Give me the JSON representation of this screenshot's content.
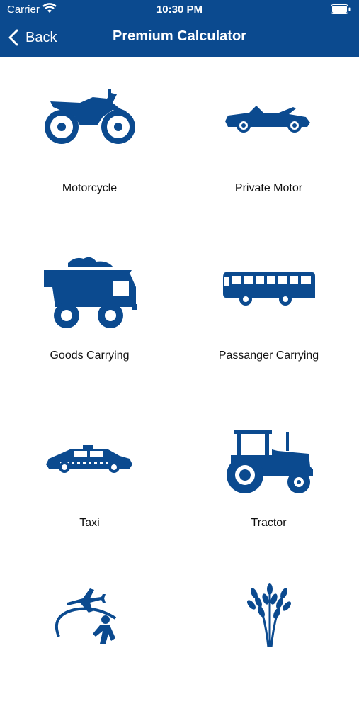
{
  "status_bar": {
    "carrier": "Carrier",
    "time": "10:30 PM",
    "wifi_icon": "wifi-icon",
    "battery_icon": "battery-icon"
  },
  "nav": {
    "back_label": "Back",
    "title": "Premium Calculator"
  },
  "colors": {
    "primary": "#0b4a8f",
    "background": "#ffffff",
    "label_text": "#111111"
  },
  "categories": [
    {
      "label": "Motorcycle",
      "icon": "motorcycle-icon"
    },
    {
      "label": "Private Motor",
      "icon": "car-icon"
    },
    {
      "label": "Goods Carrying",
      "icon": "dump-truck-icon"
    },
    {
      "label": "Passanger Carrying",
      "icon": "bus-icon"
    },
    {
      "label": "Taxi",
      "icon": "taxi-icon"
    },
    {
      "label": "Tractor",
      "icon": "tractor-icon"
    },
    {
      "label": "",
      "icon": "travel-icon"
    },
    {
      "label": "",
      "icon": "crop-icon"
    }
  ]
}
